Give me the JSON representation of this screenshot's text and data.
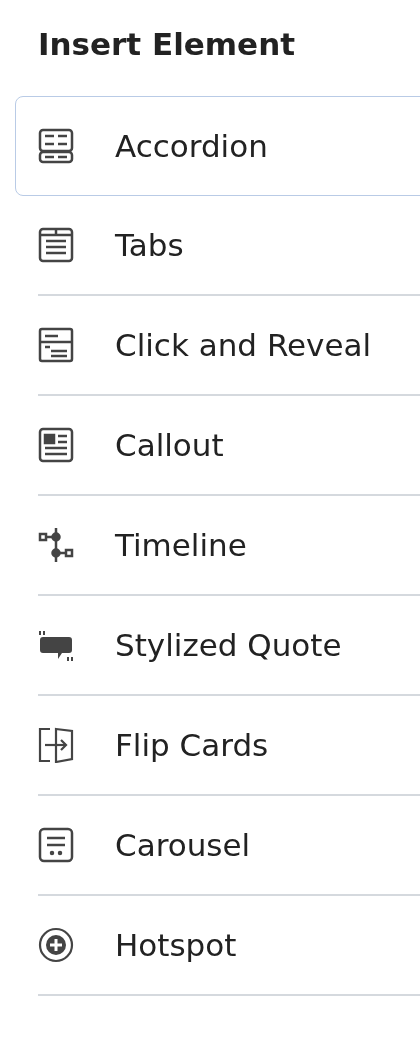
{
  "title": "Insert Element",
  "items": [
    {
      "label": "Accordion",
      "selected": true
    },
    {
      "label": "Tabs",
      "selected": false
    },
    {
      "label": "Click and Reveal",
      "selected": false
    },
    {
      "label": "Callout",
      "selected": false
    },
    {
      "label": "Timeline",
      "selected": false
    },
    {
      "label": "Stylized Quote",
      "selected": false
    },
    {
      "label": "Flip Cards",
      "selected": false
    },
    {
      "label": "Carousel",
      "selected": false
    },
    {
      "label": "Hotspot",
      "selected": false
    }
  ]
}
